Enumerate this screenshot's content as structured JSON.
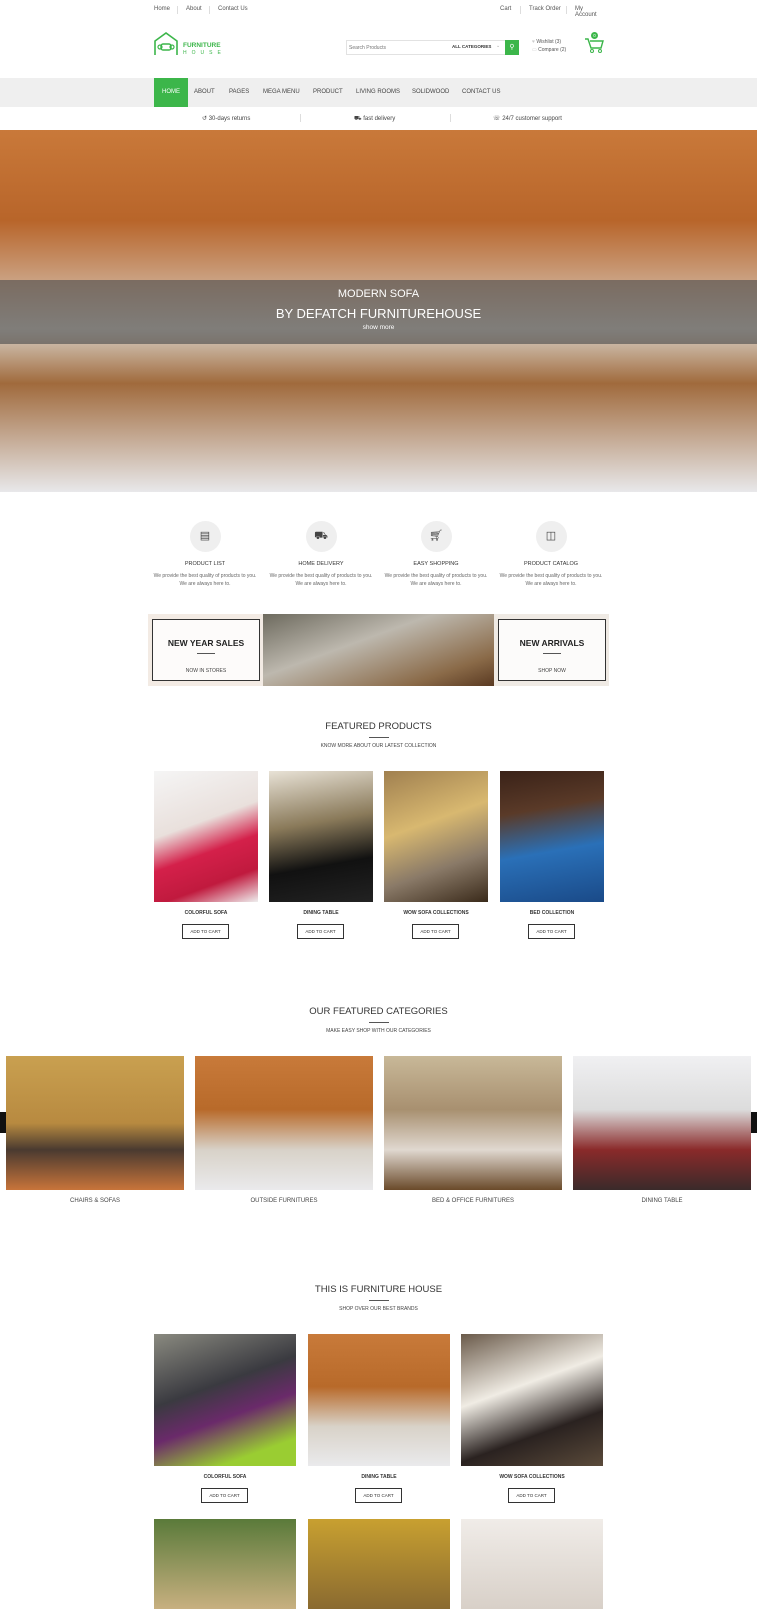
{
  "topbar": {
    "left": [
      "Home",
      "About",
      "Contact Us"
    ],
    "right": [
      "Cart",
      "Track Order",
      "My Account"
    ]
  },
  "logo": {
    "line1": "FURNITURE",
    "line2": "HOUSE"
  },
  "search": {
    "placeholder": "Search Products",
    "category": "ALL CATEGORIES"
  },
  "header": {
    "wishlist": "Wishlist (3)",
    "compare": "Compare (2)",
    "cart_count": "0"
  },
  "nav": [
    "HOME",
    "ABOUT",
    "PAGES",
    "MEGA MENU",
    "PRODUCT",
    "LIVING ROOMS",
    "SOLIDWOOD",
    "CONTACT US"
  ],
  "strip": [
    "30-days returns",
    "fast delivery",
    "24/7 customer support"
  ],
  "hero": {
    "line1": "MODERN SOFA",
    "line2": "BY DEFATCH FURNITUREHOUSE",
    "link": "show more"
  },
  "services": [
    {
      "title": "PRODUCT LIST",
      "text": "We provide the best quality of products to you. We are always here to."
    },
    {
      "title": "HOME DELIVERY",
      "text": "We provide the best quality of products to you. We are always here to."
    },
    {
      "title": "EASY SHOPPING",
      "text": "We provide the best quality of products to you. We are always here to."
    },
    {
      "title": "PRODUCT CATALOG",
      "text": "We provide the best quality of products to you. We are always here to."
    }
  ],
  "banners": [
    {
      "title": "NEW YEAR SALES",
      "sub": "NOW IN STORES"
    },
    {
      "title": "NEW ARRIVALS",
      "sub": "SHOP NOW"
    }
  ],
  "featured": {
    "title": "FEATURED PRODUCTS",
    "subtitle": "KNOW MORE ABOUT OUR LATEST COLLECTION",
    "items": [
      "COLORFUL SOFA",
      "DINING TABLE",
      "WOW SOFA COLLECTIONS",
      "BED COLLECTION"
    ],
    "button": "ADD TO CART"
  },
  "categories": {
    "title": "OUR FEATURED CATEGORIES",
    "subtitle": "MAKE EASY SHOP WITH OUR CATEGORIES",
    "items": [
      "CHAIRS & SOFAS",
      "OUTSIDE FURNITURES",
      "BED & OFFICE FURNITURES",
      "DINING TABLE"
    ]
  },
  "brands": {
    "title": "THIS IS FURNITURE HOUSE",
    "subtitle": "SHOP OVER OUR BEST BRANDS",
    "items": [
      "COLORFUL SOFA",
      "DINING TABLE",
      "WOW SOFA COLLECTIONS"
    ],
    "button": "ADD TO CART"
  },
  "colors": {
    "accent": "#3cb64a",
    "nav_bg": "#efefef"
  }
}
